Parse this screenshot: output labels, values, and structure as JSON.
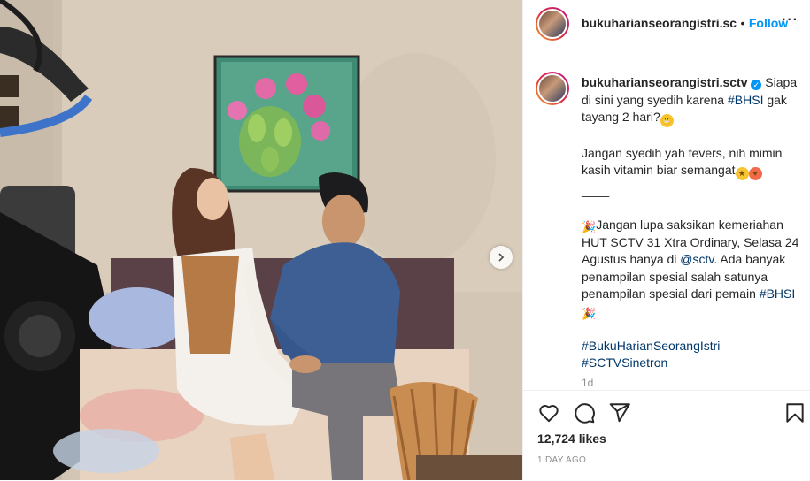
{
  "post": {
    "author": "bukuharianseorangistri.sc",
    "follow_label": "Follow",
    "separator": "•",
    "more_label": "···"
  },
  "caption": {
    "author": "bukuharianseorangistri.sctv",
    "line1_text": "Siapa di sini yang syedih karena ",
    "hashtag1": "#BHSI",
    "line1_end": " gak tayang 2 hari?",
    "para2": "Jangan syedih yah fevers, nih mimin kasih vitamin biar semangat",
    "divider": "____",
    "para3_a": "Jangan lupa saksikan kemeriahan HUT SCTV 31 Xtra Ordinary, Selasa 24 Agustus hanya di ",
    "mention": "@sctv",
    "para3_b": ". Ada banyak penampilan spesial salah satunya penampilan spesial dari pemain ",
    "hashtag2": "#BHSI",
    "hashtag3": "#BukuHarianSeorangIstri",
    "hashtag4": "#SCTVSinetron",
    "time_short": "1d"
  },
  "actions": {
    "likes": "12,724 likes",
    "time_ago": "1 DAY AGO"
  },
  "icons": [
    "heart-icon",
    "comment-icon",
    "share-icon",
    "bookmark-icon",
    "chevron-right-icon",
    "verified-icon"
  ]
}
